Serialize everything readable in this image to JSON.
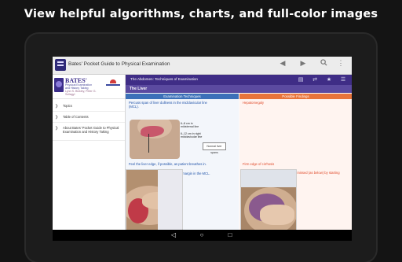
{
  "headline": "View helpful algorithms, charts, and full-color images",
  "appbar": {
    "title": "Bates' Pocket Guide to Physical Examination",
    "icons": [
      "back-arrow-icon",
      "forward-arrow-icon",
      "search-icon",
      "overflow-menu-icon"
    ]
  },
  "sidebar": {
    "logo": {
      "title": "BATES'",
      "subtitle_line1": "Physical Examination",
      "subtitle_line2": "and History Taking",
      "subtitle_line3": "Lynn S. Bickley, Peter G. Szilagyi"
    },
    "items": [
      {
        "label": "Topics"
      },
      {
        "label": "Table of Contents"
      },
      {
        "label": "About Bates' Pocket Guide to Physical Examination and History Taking"
      }
    ]
  },
  "content": {
    "toolbar_title": "The Abdomen: Techniques of Examination",
    "toolbar_icons": [
      "copy-icon",
      "sync-icon",
      "star-icon",
      "list-icon"
    ],
    "section_title": "The Liver",
    "col_left_header": "Examination Techniques",
    "col_right_header": "Possible Findings",
    "left_text_1": "Percuss span of liver dullness in the midclavicular line (MCL).",
    "left_text_2": "Feel the liver edge, if possible, as patient breathes in.",
    "left_text_3": "Measure its distance from the costal margin in the MCL.",
    "diagram_labels": {
      "a": "6–8 cm in midsternal line",
      "b": "6–12 cm in right midclavicular line",
      "callout": "Normal liver spans"
    },
    "right_text_1": "Hepatomegaly",
    "right_text_2": "Firm edge of cirrhosis",
    "right_text_3": "Increased in hepatomegaly—may be missed (as below) by starting palpation too high in the RUQ"
  },
  "systembar": {
    "icons": [
      "back-icon",
      "home-icon",
      "recents-icon"
    ]
  },
  "colors": {
    "brand": "#3f2d86",
    "section": "#5b4aa0",
    "left_header": "#3c70b8",
    "right_header": "#e8743a",
    "link_blue": "#1f52a8",
    "finding_red": "#e04a2a"
  }
}
